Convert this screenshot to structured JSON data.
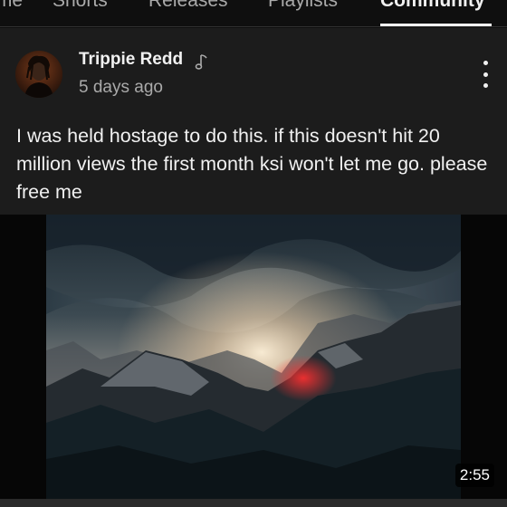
{
  "tabs": [
    {
      "label": "Home"
    },
    {
      "label": "Shorts"
    },
    {
      "label": "Releases"
    },
    {
      "label": "Playlists"
    },
    {
      "label": "Community",
      "active": true
    }
  ],
  "post": {
    "author": "Trippie Redd",
    "author_badge_icon": "music-note-icon",
    "time": "5 days ago",
    "text": "I was held hostage to do this. if this doesn't hit 20 million views the first month ksi won't let me go. please free me",
    "media": {
      "duration": "2:55"
    }
  },
  "colors": {
    "background": "#0f0f0f",
    "card": "#1c1c1c",
    "text": "#f1f1f1",
    "secondary_text": "#aaaaaa"
  }
}
